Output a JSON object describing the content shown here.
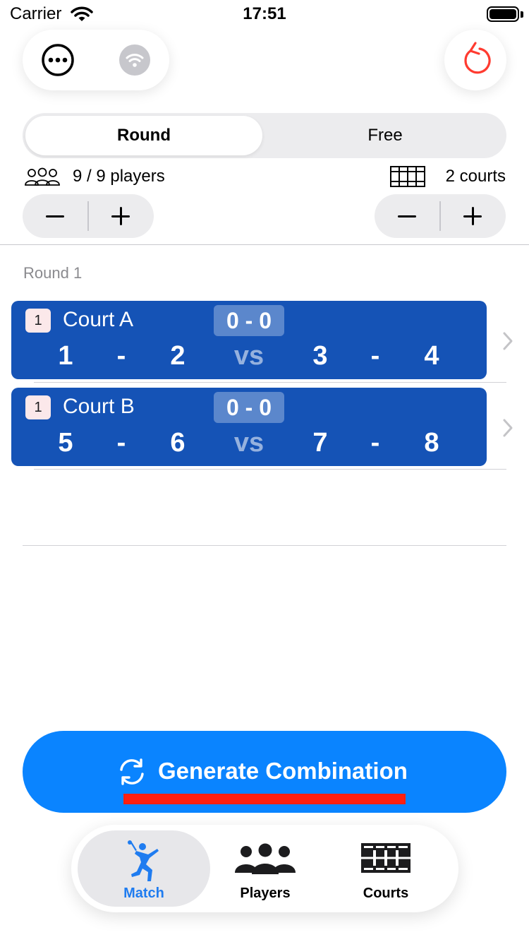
{
  "status_bar": {
    "carrier": "Carrier",
    "time": "17:51"
  },
  "toolbar": {
    "more_icon": "ellipsis-circle-icon",
    "wifi_icon": "wifi-icon",
    "reset_icon": "reset-arrow-icon",
    "reset_color": "#ff3b30"
  },
  "mode": {
    "options": [
      "Round",
      "Free"
    ],
    "selected": "Round"
  },
  "players": {
    "icon": "three-people-outline-icon",
    "label": "9 / 9 players"
  },
  "courts": {
    "icon": "court-grid-icon",
    "label": "2 courts"
  },
  "round": {
    "label": "Round 1",
    "matches": [
      {
        "badge": "1",
        "court": "Court A",
        "score": "0 - 0",
        "team1_p1": "1",
        "dash1": "-",
        "team1_p2": "2",
        "vs": "vs",
        "team2_p1": "3",
        "dash2": "-",
        "team2_p2": "4"
      },
      {
        "badge": "1",
        "court": "Court B",
        "score": "0 - 0",
        "team1_p1": "5",
        "dash1": "-",
        "team1_p2": "6",
        "vs": "vs",
        "team2_p1": "7",
        "dash2": "-",
        "team2_p2": "8"
      }
    ]
  },
  "generate": {
    "label": "Generate Combination",
    "icon": "refresh-arrows-icon",
    "color": "#0a84ff"
  },
  "tabs": [
    {
      "label": "Match",
      "icon": "badminton-player-icon",
      "selected": true
    },
    {
      "label": "Players",
      "icon": "people-filled-icon",
      "selected": false
    },
    {
      "label": "Courts",
      "icon": "courts-grid-icon",
      "selected": false
    }
  ],
  "colors": {
    "court_card": "#1553b6",
    "accent": "#1f7cf0"
  }
}
